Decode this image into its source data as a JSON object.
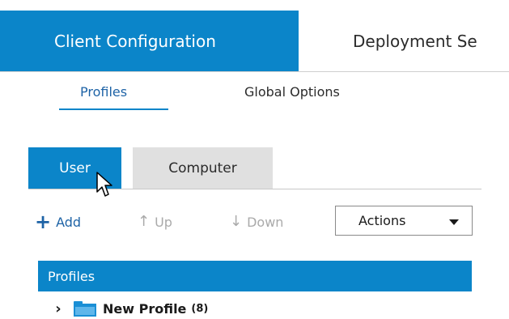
{
  "main_tabs": [
    {
      "label": "Client Configuration",
      "active": true
    },
    {
      "label": "Deployment Se",
      "active": false
    }
  ],
  "sub_tabs": [
    {
      "label": "Profiles",
      "active": true
    },
    {
      "label": "Global Options",
      "active": false
    }
  ],
  "inner_tabs": [
    {
      "label": "User",
      "active": true
    },
    {
      "label": "Computer",
      "active": false
    }
  ],
  "toolbar": {
    "add_label": "Add",
    "add_icon": "plus-icon",
    "up_label": "Up",
    "up_icon": "arrow-up-icon",
    "down_label": "Down",
    "down_icon": "arrow-down-icon",
    "actions_label": "Actions"
  },
  "grid": {
    "header": "Profiles",
    "rows": [
      {
        "name": "New Profile",
        "count": "(8)",
        "expanded": false
      }
    ]
  },
  "colors": {
    "accent": "#0b85c9",
    "inactive_tab": "#e0e0e0",
    "folder": "#1a8fd5"
  }
}
